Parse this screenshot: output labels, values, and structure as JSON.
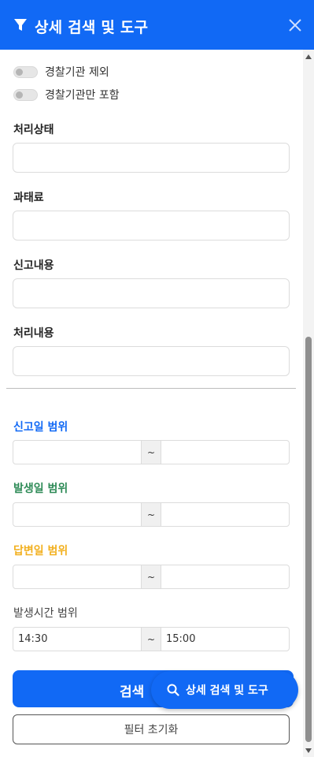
{
  "header": {
    "title": "상세 검색 및 도구"
  },
  "toggles": [
    {
      "label": "경찰기관 제외",
      "on": false
    },
    {
      "label": "경찰기관만 포함",
      "on": false
    }
  ],
  "fields": [
    {
      "label": "처리상태",
      "value": ""
    },
    {
      "label": "과태료",
      "value": ""
    },
    {
      "label": "신고내용",
      "value": ""
    },
    {
      "label": "처리내용",
      "value": ""
    }
  ],
  "ranges": [
    {
      "label": "신고일 범위",
      "color": "#1169f5",
      "from": "",
      "to": "",
      "separator": "~"
    },
    {
      "label": "발생일 범위",
      "color": "#2e8b57",
      "from": "",
      "to": "",
      "separator": "~"
    },
    {
      "label": "답변일 범위",
      "color": "#f2b01e",
      "from": "",
      "to": "",
      "separator": "~"
    },
    {
      "label": "발생시간 범위",
      "color": "#444444",
      "from": "14:30",
      "to": "15:00",
      "separator": "~"
    }
  ],
  "actions": {
    "search_label": "검색",
    "reset_label": "필터 초기화"
  },
  "fab": {
    "label": "상세 검색 및 도구"
  },
  "colors": {
    "accent": "#1169f5"
  }
}
